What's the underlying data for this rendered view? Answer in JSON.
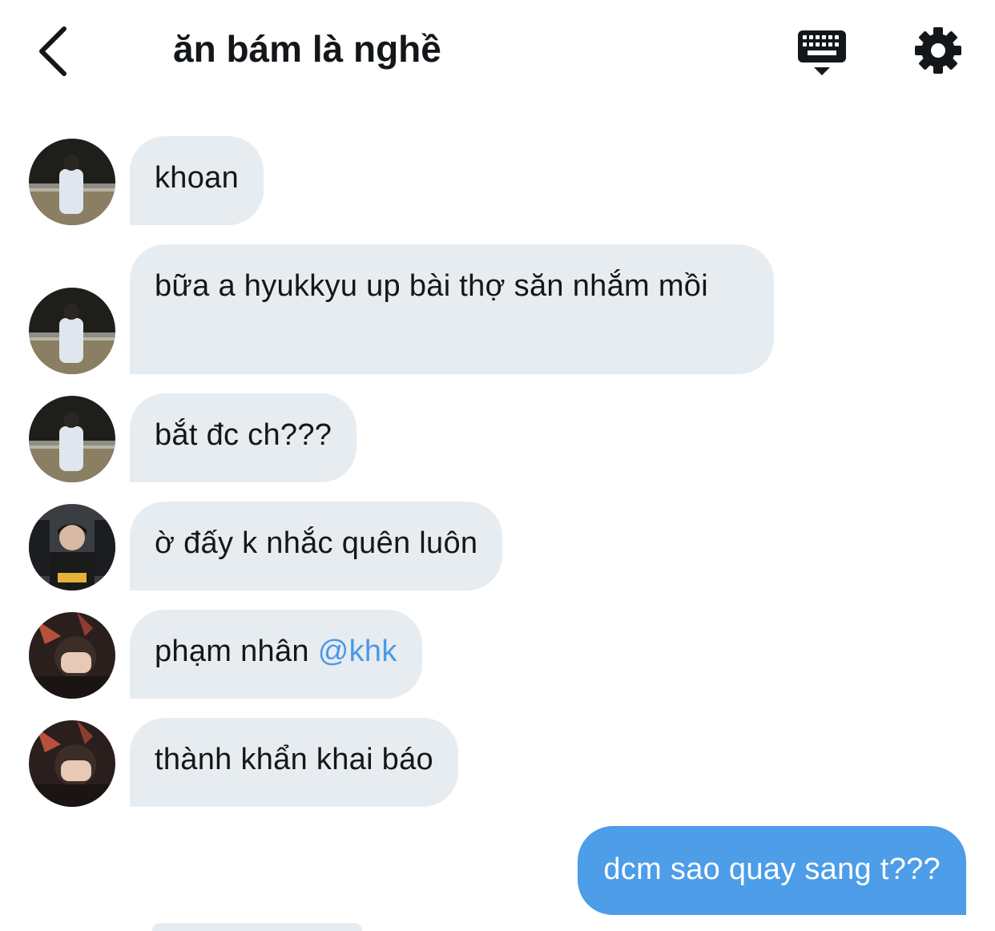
{
  "header": {
    "title": "ăn bám là nghề",
    "back_icon": "chevron-left-icon",
    "keyboard_icon": "keyboard-icon",
    "settings_icon": "gear-icon"
  },
  "messages": [
    {
      "direction": "in",
      "avatar": "avatar-user-1",
      "text": "khoan"
    },
    {
      "direction": "in",
      "avatar": "avatar-user-1",
      "text": "bữa a hyukkyu up bài thợ săn nhắm mồi"
    },
    {
      "direction": "in",
      "avatar": "avatar-user-1",
      "text": "bắt đc ch???"
    },
    {
      "direction": "in",
      "avatar": "avatar-user-2",
      "text": "ờ đấy k nhắc quên luôn"
    },
    {
      "direction": "in",
      "avatar": "avatar-user-3",
      "text": "phạm nhân ",
      "mention": "@khk"
    },
    {
      "direction": "in",
      "avatar": "avatar-user-3",
      "text": "thành khẩn khai báo"
    },
    {
      "direction": "out",
      "text": "dcm sao quay sang t???"
    }
  ],
  "colors": {
    "incoming_bubble": "#e6ecf0",
    "outgoing_bubble": "#4d9de8",
    "mention": "#4a99e9",
    "text": "#14171a"
  }
}
